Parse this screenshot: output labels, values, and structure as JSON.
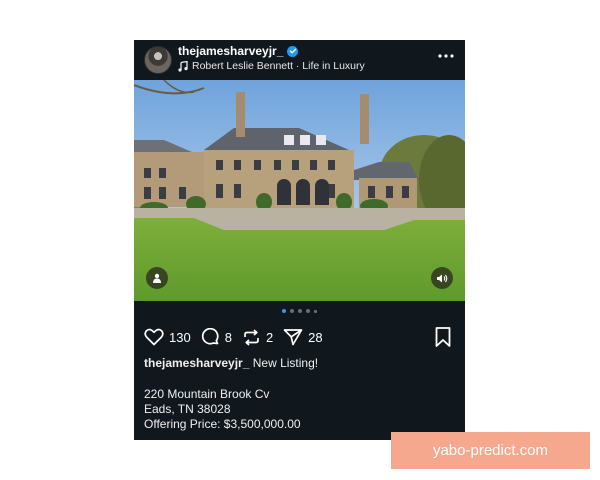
{
  "post": {
    "username": "thejamesharveyjr_",
    "audio": "Robert Leslie Bennett · Life in Luxury",
    "likes": "130",
    "comments": "8",
    "reposts": "2",
    "shares": "28",
    "carousel": {
      "total": 5,
      "active": 1
    },
    "caption": {
      "username": "thejamesharveyjr_",
      "text": "New Listing!",
      "address_line1": "220 Mountain Brook Cv",
      "address_line2": "Eads, TN 38028",
      "price": "Offering Price: $3,500,000.00"
    }
  },
  "icons": [
    "avatar",
    "verified-badge-icon",
    "music-note-icon",
    "more-icon",
    "profile-icon",
    "sound-icon",
    "heart-icon",
    "comment-icon",
    "repost-icon",
    "share-icon",
    "bookmark-icon"
  ],
  "colors": {
    "post_bg": "#10171d",
    "verified": "#1d9bf0",
    "active_dot": "#4a8bf0",
    "watermark_bg": "#f5a88e"
  },
  "watermark": "yabo-predict.com"
}
